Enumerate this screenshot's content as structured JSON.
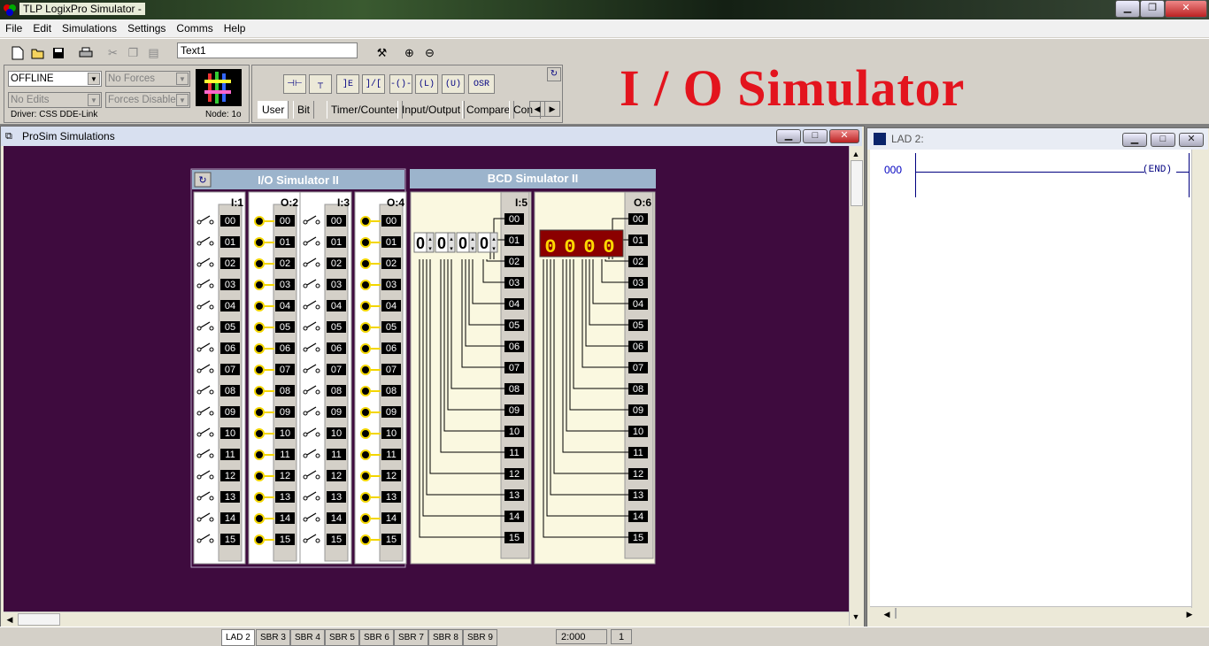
{
  "window": {
    "title": "TLP LogixPro Simulator  -"
  },
  "menu": [
    "File",
    "Edit",
    "Simulations",
    "Settings",
    "Comms",
    "Help"
  ],
  "toolbar": {
    "text_field": "Text1"
  },
  "status": {
    "mode": "OFFLINE",
    "forces": "No Forces",
    "edits": "No Edits",
    "forces_enabled": "Forces Disabled",
    "driver": "Driver: CSS DDE-Link",
    "node": "Node: 1o"
  },
  "palette": {
    "osr_label": "OSR",
    "tabs": [
      "User",
      "Bit",
      "Timer/Counter",
      "Input/Output",
      "Compare",
      "Con"
    ]
  },
  "overlay_title": "I / O Simulator",
  "prosim": {
    "title": "ProSim Simulations",
    "io_panel_title": "I/O Simulator II",
    "bcd_panel_title": "BCD Simulator II",
    "slots": [
      "I:1",
      "O:2",
      "I:3",
      "O:4"
    ],
    "bcd_slots": [
      "I:5",
      "O:6"
    ],
    "bits": [
      "00",
      "01",
      "02",
      "03",
      "04",
      "05",
      "06",
      "07",
      "08",
      "09",
      "10",
      "11",
      "12",
      "13",
      "14",
      "15"
    ],
    "thumbwheel": [
      "0",
      "0",
      "0",
      "0"
    ],
    "led_display": [
      "0",
      "0",
      "0",
      "0"
    ]
  },
  "lad": {
    "title": "LAD 2:",
    "rung_number": "000",
    "end_label": "END"
  },
  "statusbar": {
    "tabs": [
      "LAD 2",
      "SBR 3",
      "SBR 4",
      "SBR 5",
      "SBR 6",
      "SBR 7",
      "SBR 8",
      "SBR 9"
    ],
    "address": "2:000",
    "count": "1"
  }
}
